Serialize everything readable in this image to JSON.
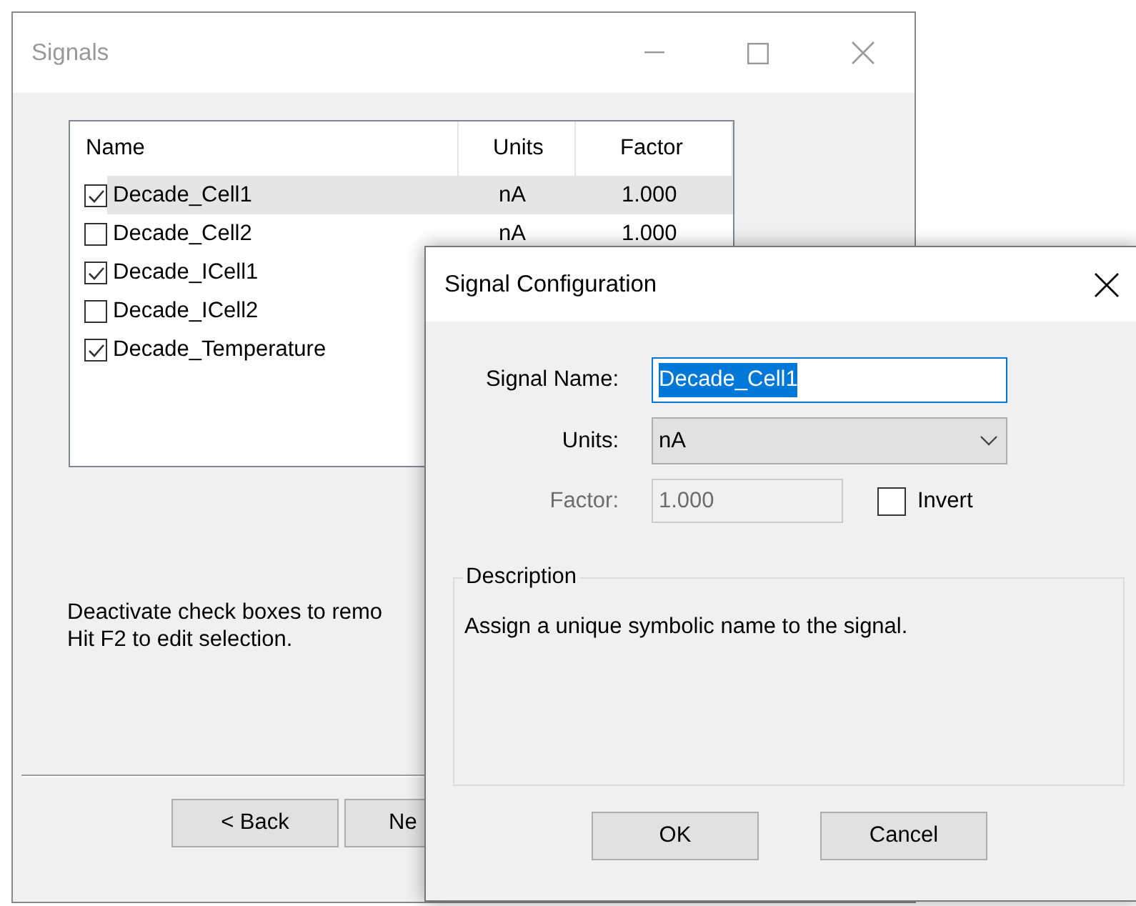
{
  "main_window": {
    "title": "Signals",
    "active": false,
    "list": {
      "columns": [
        "Name",
        "Units",
        "Factor"
      ],
      "rows": [
        {
          "name": "Decade_Cell1",
          "units": "nA",
          "factor": "1.000",
          "checked": true,
          "selected": true
        },
        {
          "name": "Decade_Cell2",
          "units": "nA",
          "factor": "1.000",
          "checked": false,
          "selected": false
        },
        {
          "name": "Decade_ICell1",
          "checked": true,
          "selected": false
        },
        {
          "name": "Decade_ICell2",
          "checked": false,
          "selected": false
        },
        {
          "name": "Decade_Temperature",
          "checked": true,
          "selected": false
        }
      ]
    },
    "hint_lines": [
      "Deactivate check boxes to remo",
      "Hit F2 to edit selection."
    ],
    "buttons": [
      "< Back",
      "Ne"
    ]
  },
  "dialog": {
    "title": "Signal Configuration",
    "signal_name": {
      "label": "Signal Name:",
      "value": "Decade_Cell1",
      "text_selected": true
    },
    "units": {
      "label": "Units:",
      "value": "nA"
    },
    "factor": {
      "label": "Factor:",
      "value": "1.000",
      "disabled": true
    },
    "invert": {
      "label": "Invert",
      "checked": false
    },
    "description": {
      "title": "Description",
      "text": "Assign a unique symbolic name to the signal."
    },
    "buttons": [
      "OK",
      "Cancel"
    ]
  }
}
